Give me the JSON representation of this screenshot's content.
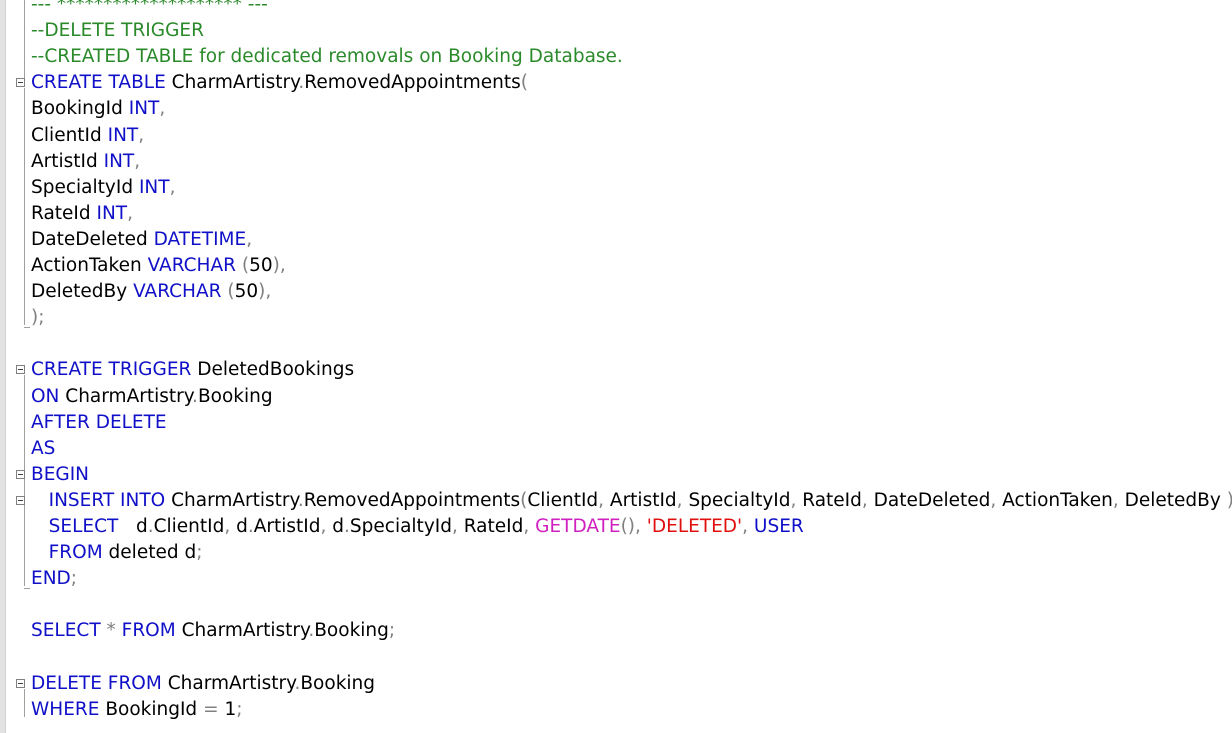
{
  "editor": {
    "lines": [
      {
        "tokens": [
          {
            "t": "--- ******************** ---",
            "c": "cm"
          }
        ]
      },
      {
        "tokens": [
          {
            "t": "--DELETE TRIGGER",
            "c": "cm"
          }
        ]
      },
      {
        "tokens": [
          {
            "t": "--CREATED TABLE for dedicated removals on Booking Database.",
            "c": "cm"
          }
        ]
      },
      {
        "fold": "start",
        "tokens": [
          {
            "t": "CREATE TABLE",
            "c": "kw"
          },
          {
            "t": " CharmArtistry",
            "c": "id"
          },
          {
            "t": ".",
            "c": "pn"
          },
          {
            "t": "RemovedAppointments",
            "c": "id"
          },
          {
            "t": "(",
            "c": "pn"
          }
        ]
      },
      {
        "tokens": [
          {
            "t": "BookingId ",
            "c": "id"
          },
          {
            "t": "INT",
            "c": "kw"
          },
          {
            "t": ",",
            "c": "pn"
          }
        ]
      },
      {
        "tokens": [
          {
            "t": "ClientId ",
            "c": "id"
          },
          {
            "t": "INT",
            "c": "kw"
          },
          {
            "t": ",",
            "c": "pn"
          }
        ]
      },
      {
        "tokens": [
          {
            "t": "ArtistId ",
            "c": "id"
          },
          {
            "t": "INT",
            "c": "kw"
          },
          {
            "t": ",",
            "c": "pn"
          }
        ]
      },
      {
        "tokens": [
          {
            "t": "SpecialtyId ",
            "c": "id"
          },
          {
            "t": "INT",
            "c": "kw"
          },
          {
            "t": ",",
            "c": "pn"
          }
        ]
      },
      {
        "tokens": [
          {
            "t": "RateId ",
            "c": "id"
          },
          {
            "t": "INT",
            "c": "kw"
          },
          {
            "t": ",",
            "c": "pn"
          }
        ]
      },
      {
        "tokens": [
          {
            "t": "DateDeleted ",
            "c": "id"
          },
          {
            "t": "DATETIME",
            "c": "kw"
          },
          {
            "t": ",",
            "c": "pn"
          }
        ]
      },
      {
        "tokens": [
          {
            "t": "ActionTaken ",
            "c": "id"
          },
          {
            "t": "VARCHAR ",
            "c": "kw"
          },
          {
            "t": "(",
            "c": "pn"
          },
          {
            "t": "50",
            "c": "id"
          },
          {
            "t": "),",
            "c": "pn"
          }
        ]
      },
      {
        "tokens": [
          {
            "t": "DeletedBy ",
            "c": "id"
          },
          {
            "t": "VARCHAR ",
            "c": "kw"
          },
          {
            "t": "(",
            "c": "pn"
          },
          {
            "t": "50",
            "c": "id"
          },
          {
            "t": "),",
            "c": "pn"
          }
        ]
      },
      {
        "fold": "end",
        "tokens": [
          {
            "t": ");",
            "c": "pn"
          }
        ]
      },
      {
        "tokens": []
      },
      {
        "fold": "start",
        "tokens": [
          {
            "t": "CREATE TRIGGER",
            "c": "kw"
          },
          {
            "t": " DeletedBookings",
            "c": "id"
          }
        ]
      },
      {
        "tokens": [
          {
            "t": "ON",
            "c": "kw"
          },
          {
            "t": " CharmArtistry",
            "c": "id"
          },
          {
            "t": ".",
            "c": "pn"
          },
          {
            "t": "Booking",
            "c": "id"
          }
        ]
      },
      {
        "tokens": [
          {
            "t": "AFTER DELETE",
            "c": "kw"
          }
        ]
      },
      {
        "tokens": [
          {
            "t": "AS",
            "c": "kw"
          }
        ]
      },
      {
        "fold": "start",
        "tokens": [
          {
            "t": "BEGIN",
            "c": "kw"
          }
        ]
      },
      {
        "fold": "start",
        "tokens": [
          {
            "t": "   INSERT INTO",
            "c": "kw"
          },
          {
            "t": " CharmArtistry",
            "c": "id"
          },
          {
            "t": ".",
            "c": "pn"
          },
          {
            "t": "RemovedAppointments",
            "c": "id"
          },
          {
            "t": "(",
            "c": "pn"
          },
          {
            "t": "ClientId",
            "c": "id"
          },
          {
            "t": ", ",
            "c": "pn"
          },
          {
            "t": "ArtistId",
            "c": "id"
          },
          {
            "t": ", ",
            "c": "pn"
          },
          {
            "t": "SpecialtyId",
            "c": "id"
          },
          {
            "t": ", ",
            "c": "pn"
          },
          {
            "t": "RateId",
            "c": "id"
          },
          {
            "t": ", ",
            "c": "pn"
          },
          {
            "t": "DateDeleted",
            "c": "id"
          },
          {
            "t": ", ",
            "c": "pn"
          },
          {
            "t": "ActionTaken",
            "c": "id"
          },
          {
            "t": ", ",
            "c": "pn"
          },
          {
            "t": "DeletedBy ",
            "c": "id"
          },
          {
            "t": ")",
            "c": "pn"
          }
        ]
      },
      {
        "tokens": [
          {
            "t": "   SELECT",
            "c": "kw"
          },
          {
            "t": "   d",
            "c": "id"
          },
          {
            "t": ".",
            "c": "pn"
          },
          {
            "t": "ClientId",
            "c": "id"
          },
          {
            "t": ", ",
            "c": "pn"
          },
          {
            "t": "d",
            "c": "id"
          },
          {
            "t": ".",
            "c": "pn"
          },
          {
            "t": "ArtistId",
            "c": "id"
          },
          {
            "t": ", ",
            "c": "pn"
          },
          {
            "t": "d",
            "c": "id"
          },
          {
            "t": ".",
            "c": "pn"
          },
          {
            "t": "SpecialtyId",
            "c": "id"
          },
          {
            "t": ", ",
            "c": "pn"
          },
          {
            "t": "RateId",
            "c": "id"
          },
          {
            "t": ", ",
            "c": "pn"
          },
          {
            "t": "GETDATE",
            "c": "fn"
          },
          {
            "t": "(), ",
            "c": "pn"
          },
          {
            "t": "'DELETED'",
            "c": "st"
          },
          {
            "t": ", ",
            "c": "pn"
          },
          {
            "t": "USER",
            "c": "kw"
          }
        ]
      },
      {
        "tokens": [
          {
            "t": "   FROM",
            "c": "kw"
          },
          {
            "t": " deleted d",
            "c": "id"
          },
          {
            "t": ";",
            "c": "pn"
          }
        ]
      },
      {
        "fold": "end",
        "tokens": [
          {
            "t": "END",
            "c": "kw"
          },
          {
            "t": ";",
            "c": "pn"
          }
        ]
      },
      {
        "tokens": []
      },
      {
        "tokens": [
          {
            "t": "SELECT ",
            "c": "kw"
          },
          {
            "t": "* ",
            "c": "pn"
          },
          {
            "t": "FROM",
            "c": "kw"
          },
          {
            "t": " CharmArtistry",
            "c": "id"
          },
          {
            "t": ".",
            "c": "pn"
          },
          {
            "t": "Booking",
            "c": "id"
          },
          {
            "t": ";",
            "c": "pn"
          }
        ]
      },
      {
        "tokens": []
      },
      {
        "fold": "start",
        "tokens": [
          {
            "t": "DELETE FROM",
            "c": "kw"
          },
          {
            "t": " CharmArtistry",
            "c": "id"
          },
          {
            "t": ".",
            "c": "pn"
          },
          {
            "t": "Booking",
            "c": "id"
          }
        ]
      },
      {
        "tokens": [
          {
            "t": "WHERE",
            "c": "kw"
          },
          {
            "t": " BookingId ",
            "c": "id"
          },
          {
            "t": "= ",
            "c": "pn"
          },
          {
            "t": "1",
            "c": "id"
          },
          {
            "t": ";",
            "c": "pn"
          }
        ]
      }
    ]
  }
}
